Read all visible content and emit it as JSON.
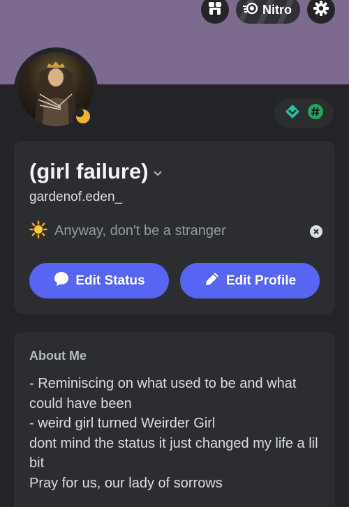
{
  "header": {
    "nitro_label": "Nitro"
  },
  "profile": {
    "display_name": "(girl failure)",
    "username": "gardenof.eden_",
    "status_emoji": "sun",
    "status_text": "Anyway, don't be a stranger"
  },
  "actions": {
    "edit_status_label": "Edit Status",
    "edit_profile_label": "Edit Profile"
  },
  "about": {
    "title": "About Me",
    "text": "- Reminiscing on what used to be and what could have been\n- weird girl turned Weirder Girl\ndont mind the status it just changed my life a lil bit\nPray for us, our lady of sorrows"
  },
  "colors": {
    "banner": "#7d6a8f",
    "background": "#232428",
    "card": "#2b2d31",
    "accent": "#5865f2",
    "idle_status": "#f0b232",
    "badge_green": "#23a55a"
  },
  "icons": {
    "shop": "shop-icon",
    "nitro": "nitro-icon",
    "settings": "gear-icon",
    "status": "idle-moon-icon",
    "badge_1": "hypesquad-icon",
    "badge_2": "hashtag-badge-icon",
    "clear": "close-icon",
    "edit_status": "chat-bubble-icon",
    "edit_profile": "pencil-icon"
  }
}
